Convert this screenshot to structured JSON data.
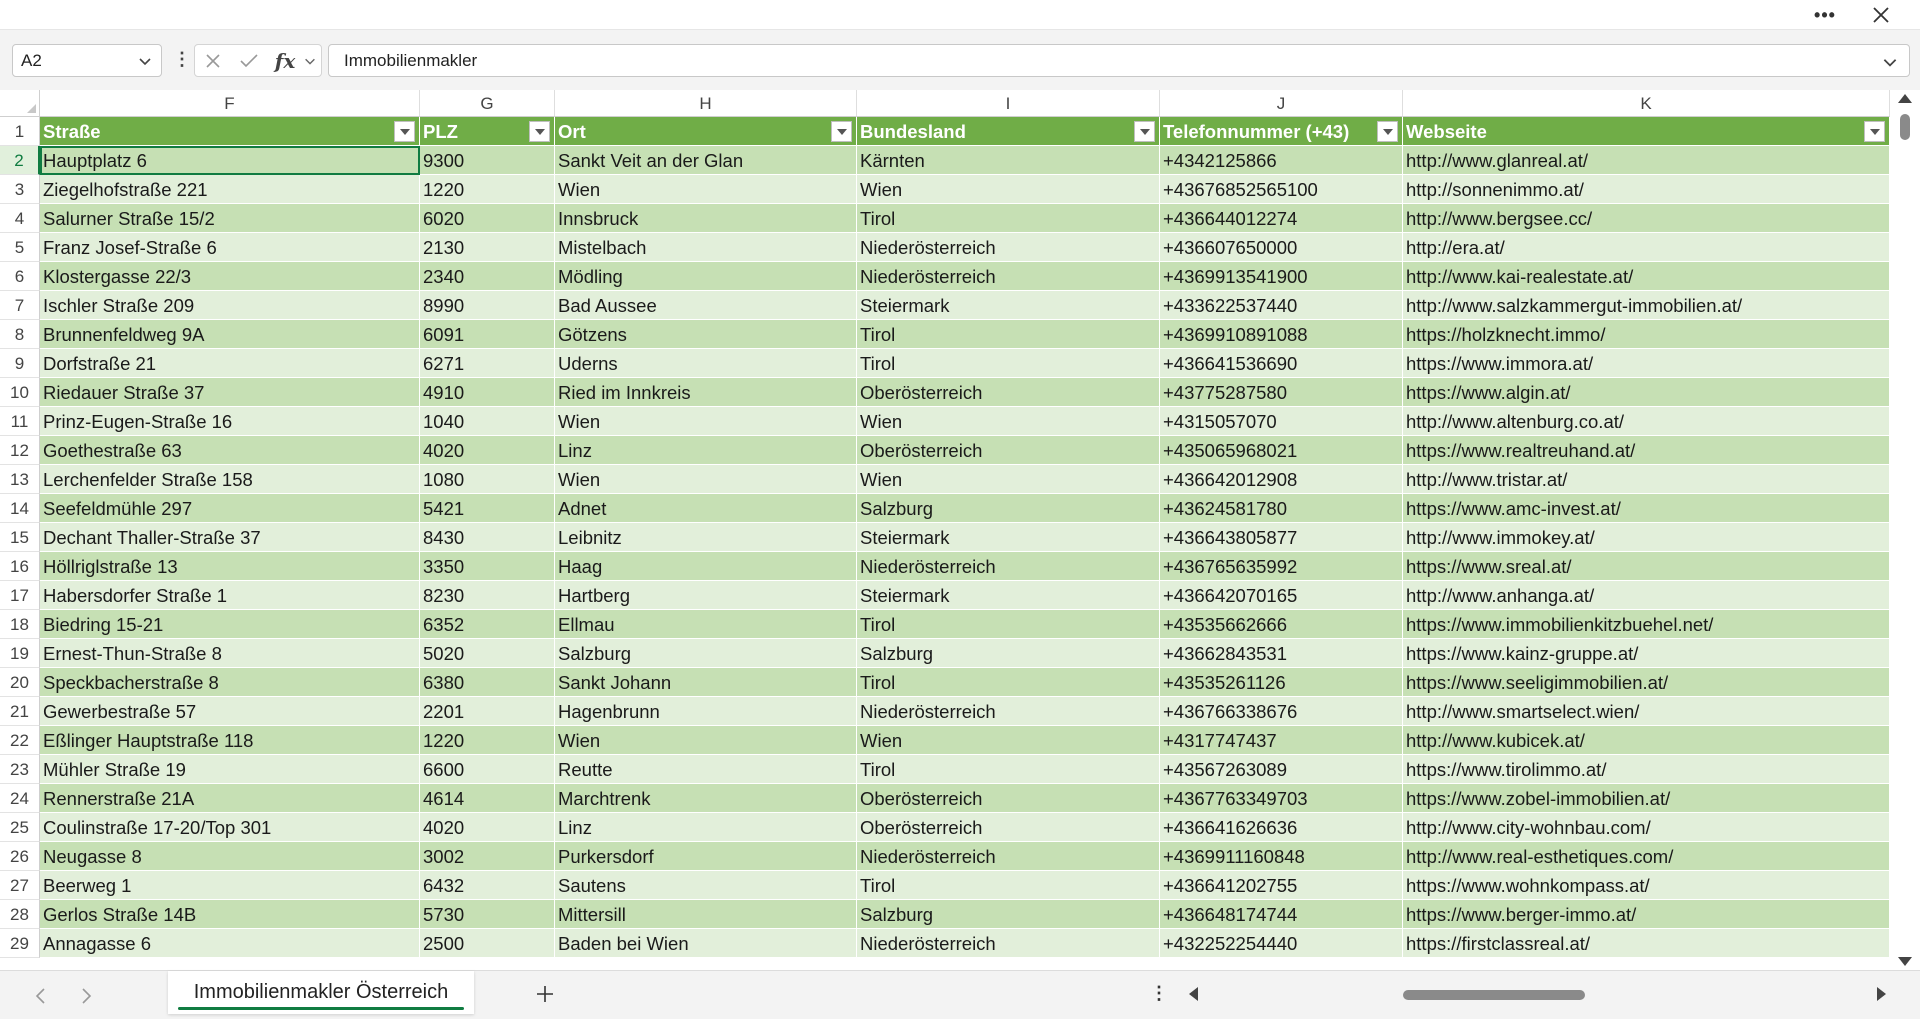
{
  "window": {
    "more_icon": "more-icon",
    "close_icon": "close-icon"
  },
  "formula_bar": {
    "name_box": "A2",
    "content": "Immobilienmakler",
    "cancel_icon": "cancel-icon",
    "enter_icon": "check-icon",
    "fx_icon": "fx-icon"
  },
  "columns": [
    {
      "letter": "F",
      "header": "Straße"
    },
    {
      "letter": "G",
      "header": "PLZ"
    },
    {
      "letter": "H",
      "header": "Ort"
    },
    {
      "letter": "I",
      "header": "Bundesland"
    },
    {
      "letter": "J",
      "header": "Telefonnummer (+43)"
    },
    {
      "letter": "K",
      "header": "Webseite"
    }
  ],
  "rows": [
    {
      "num": "2",
      "cells": [
        "Hauptplatz 6",
        "9300",
        "Sankt Veit an der Glan",
        "Kärnten",
        "+4342125866",
        "http://www.glanreal.at/"
      ]
    },
    {
      "num": "3",
      "cells": [
        "Ziegelhofstraße 221",
        "1220",
        "Wien",
        "Wien",
        "+43676852565100",
        "http://sonnenimmo.at/"
      ]
    },
    {
      "num": "4",
      "cells": [
        "Salurner Straße 15/2",
        "6020",
        "Innsbruck",
        "Tirol",
        "+436644012274",
        "http://www.bergsee.cc/"
      ]
    },
    {
      "num": "5",
      "cells": [
        "Franz Josef-Straße 6",
        "2130",
        "Mistelbach",
        "Niederösterreich",
        "+436607650000",
        "http://era.at/"
      ]
    },
    {
      "num": "6",
      "cells": [
        "Klostergasse 22/3",
        "2340",
        "Mödling",
        "Niederösterreich",
        "+4369913541900",
        "http://www.kai-realestate.at/"
      ]
    },
    {
      "num": "7",
      "cells": [
        "Ischler Straße 209",
        "8990",
        "Bad Aussee",
        "Steiermark",
        "+433622537440",
        "http://www.salzkammergut-immobilien.at/"
      ]
    },
    {
      "num": "8",
      "cells": [
        "Brunnenfeldweg 9A",
        "6091",
        "Götzens",
        "Tirol",
        "+4369910891088",
        "https://holzknecht.immo/"
      ]
    },
    {
      "num": "9",
      "cells": [
        "Dorfstraße 21",
        "6271",
        "Uderns",
        "Tirol",
        "+436641536690",
        "https://www.immora.at/"
      ]
    },
    {
      "num": "10",
      "cells": [
        "Riedauer Straße 37",
        "4910",
        "Ried im Innkreis",
        "Oberösterreich",
        "+43775287580",
        "https://www.algin.at/"
      ]
    },
    {
      "num": "11",
      "cells": [
        "Prinz-Eugen-Straße 16",
        "1040",
        "Wien",
        "Wien",
        "+4315057070",
        "http://www.altenburg.co.at/"
      ]
    },
    {
      "num": "12",
      "cells": [
        "Goethestraße 63",
        "4020",
        "Linz",
        "Oberösterreich",
        "+435065968021",
        "https://www.realtreuhand.at/"
      ]
    },
    {
      "num": "13",
      "cells": [
        "Lerchenfelder Straße 158",
        "1080",
        "Wien",
        "Wien",
        "+436642012908",
        "http://www.tristar.at/"
      ]
    },
    {
      "num": "14",
      "cells": [
        "Seefeldmühle 297",
        "5421",
        "Adnet",
        "Salzburg",
        "+43624581780",
        "https://www.amc-invest.at/"
      ]
    },
    {
      "num": "15",
      "cells": [
        "Dechant Thaller-Straße 37",
        "8430",
        "Leibnitz",
        "Steiermark",
        "+436643805877",
        "http://www.immokey.at/"
      ]
    },
    {
      "num": "16",
      "cells": [
        "Höllriglstraße 13",
        "3350",
        "Haag",
        "Niederösterreich",
        "+436765635992",
        "https://www.sreal.at/"
      ]
    },
    {
      "num": "17",
      "cells": [
        "Habersdorfer Straße 1",
        "8230",
        "Hartberg",
        "Steiermark",
        "+436642070165",
        "http://www.anhanga.at/"
      ]
    },
    {
      "num": "18",
      "cells": [
        "Biedring 15-21",
        "6352",
        "Ellmau",
        "Tirol",
        "+43535662666",
        "https://www.immobilienkitzbuehel.net/"
      ]
    },
    {
      "num": "19",
      "cells": [
        "Ernest-Thun-Straße 8",
        "5020",
        "Salzburg",
        "Salzburg",
        "+43662843531",
        "https://www.kainz-gruppe.at/"
      ]
    },
    {
      "num": "20",
      "cells": [
        "Speckbacherstraße 8",
        "6380",
        "Sankt Johann",
        "Tirol",
        "+43535261126",
        "https://www.seeligimmobilien.at/"
      ]
    },
    {
      "num": "21",
      "cells": [
        "Gewerbestraße 57",
        "2201",
        "Hagenbrunn",
        "Niederösterreich",
        "+436766338676",
        "http://www.smartselect.wien/"
      ]
    },
    {
      "num": "22",
      "cells": [
        "Eßlinger Hauptstraße 118",
        "1220",
        "Wien",
        "Wien",
        "+4317747437",
        "http://www.kubicek.at/"
      ]
    },
    {
      "num": "23",
      "cells": [
        "Mühler Straße 19",
        "6600",
        "Reutte",
        "Tirol",
        "+43567263089",
        "https://www.tirolimmo.at/"
      ]
    },
    {
      "num": "24",
      "cells": [
        "Rennerstraße 21A",
        "4614",
        "Marchtrenk",
        "Oberösterreich",
        "+4367763349703",
        "https://www.zobel-immobilien.at/"
      ]
    },
    {
      "num": "25",
      "cells": [
        "Coulinstraße 17-20/Top 301",
        "4020",
        "Linz",
        "Oberösterreich",
        "+436641626636",
        "http://www.city-wohnbau.com/"
      ]
    },
    {
      "num": "26",
      "cells": [
        "Neugasse 8",
        "3002",
        "Purkersdorf",
        "Niederösterreich",
        "+4369911160848",
        "http://www.real-esthetiques.com/"
      ]
    },
    {
      "num": "27",
      "cells": [
        "Beerweg 1",
        "6432",
        "Sautens",
        "Tirol",
        "+436641202755",
        "https://www.wohnkompass.at/"
      ]
    },
    {
      "num": "28",
      "cells": [
        "Gerlos Straße 14B",
        "5730",
        "Mittersill",
        "Salzburg",
        "+436648174744",
        "https://www.berger-immo.at/"
      ]
    },
    {
      "num": "29",
      "cells": [
        "Annagasse 6",
        "2500",
        "Baden bei Wien",
        "Niederösterreich",
        "+432252254440",
        "https://firstclassreal.at/"
      ]
    }
  ],
  "sheet_tabs": [
    {
      "label": "Immobilienmakler Österreich",
      "active": true
    }
  ],
  "bottom": {
    "prev_icon": "chevron-left-icon",
    "next_icon": "chevron-right-icon",
    "add_icon": "add-sheet-icon"
  },
  "colors": {
    "header_green": "#70ad47",
    "band_dark": "#c6e0b4",
    "band_light": "#e2efda",
    "accent": "#107c41"
  }
}
